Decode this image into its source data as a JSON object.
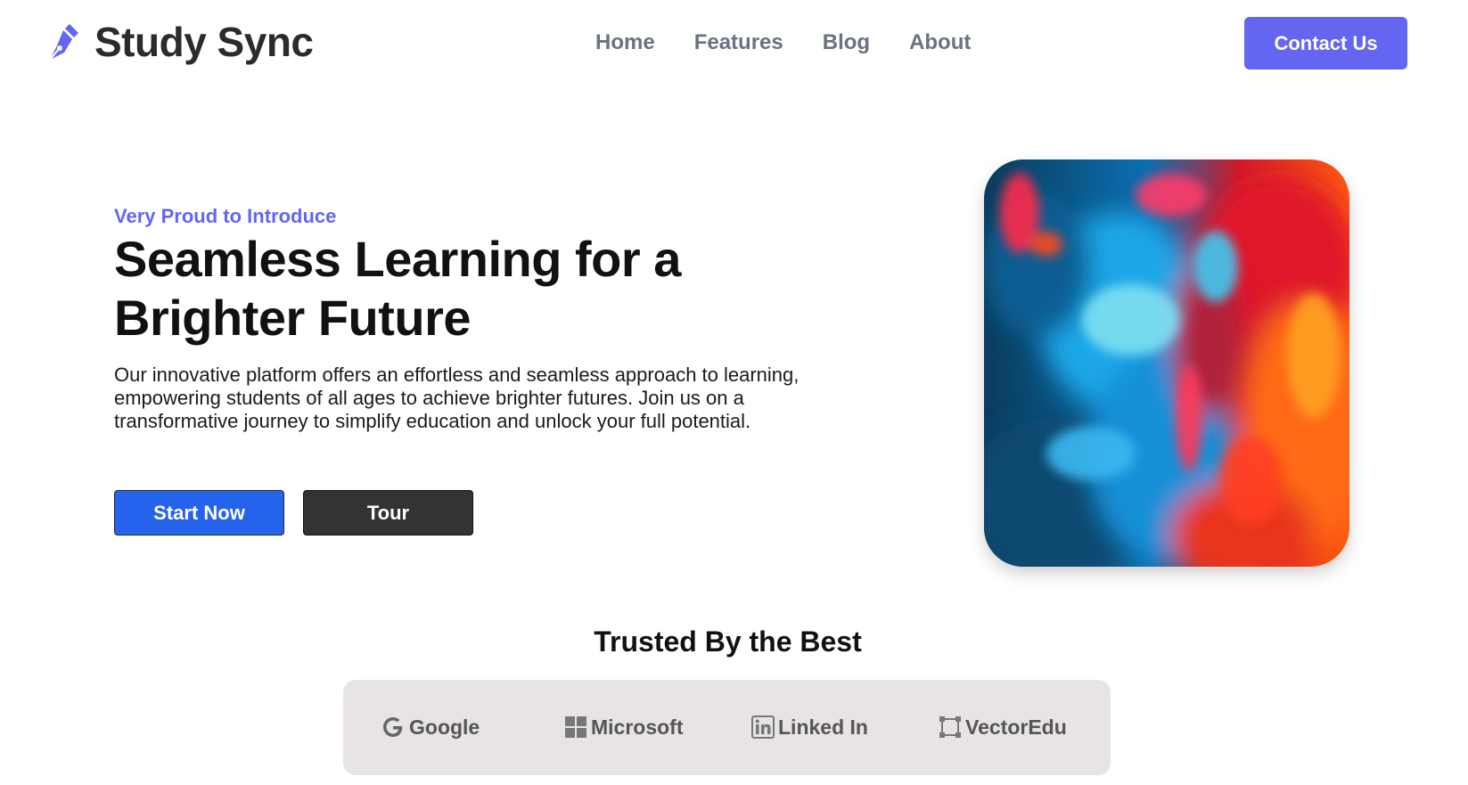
{
  "header": {
    "brand": "Study Sync",
    "logo_icon": "pen-nib-icon",
    "nav": [
      {
        "label": "Home"
      },
      {
        "label": "Features"
      },
      {
        "label": "Blog"
      },
      {
        "label": "About"
      }
    ],
    "contact_label": "Contact Us"
  },
  "hero": {
    "eyebrow": "Very Proud to Introduce",
    "headline": "Seamless Learning for a Brighter Future",
    "description": "Our innovative platform offers an effortless and seamless approach to learning, empowering students of all ages to achieve brighter futures. Join us on a transformative journey to simplify education and unlock your full potential.",
    "primary_button": "Start Now",
    "secondary_button": "Tour"
  },
  "trusted": {
    "title": "Trusted By the Best",
    "partners": [
      {
        "name": "Google",
        "icon": "google-icon"
      },
      {
        "name": "Microsoft",
        "icon": "microsoft-icon"
      },
      {
        "name": "Linked In",
        "icon": "linkedin-icon"
      },
      {
        "name": "VectorEdu",
        "icon": "vector-icon"
      }
    ]
  },
  "colors": {
    "accent": "#6366f1",
    "primary_button": "#2563eb",
    "dark_button": "#333333",
    "partner_bar": "#e8e4e4"
  }
}
